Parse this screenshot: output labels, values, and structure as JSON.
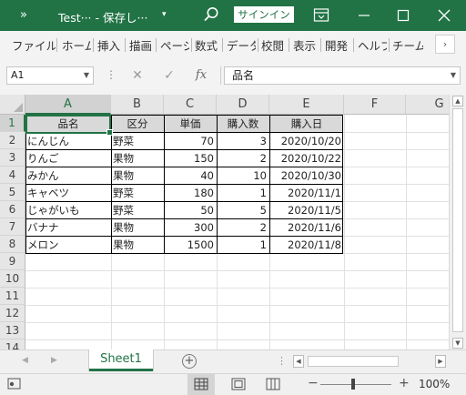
{
  "titlebar": {
    "quick_access": "»",
    "title": "Test··· - 保存し···",
    "title_dropdown": "▾",
    "signin": "サインイン"
  },
  "ribbon": {
    "tabs": [
      "ファイル",
      "ホーム",
      "挿入",
      "描画",
      "ページ",
      "数式",
      "データ",
      "校閲",
      "表示",
      "開発",
      "ヘルプ",
      "チーム"
    ]
  },
  "formula_bar": {
    "name_box": "A1",
    "cancel": "✕",
    "enter": "✓",
    "fx": "fx",
    "content": "品名",
    "dots": "⋮"
  },
  "grid": {
    "columns": [
      "A",
      "B",
      "C",
      "D",
      "E",
      "F",
      "G"
    ],
    "rows": [
      "1",
      "2",
      "3",
      "4",
      "5",
      "6",
      "7",
      "8",
      "9",
      "10",
      "11",
      "12",
      "13",
      "14"
    ],
    "header": [
      "品名",
      "区分",
      "単価",
      "購入数",
      "購入日"
    ],
    "data": [
      [
        "にんじん",
        "野菜",
        "70",
        "3",
        "2020/10/20"
      ],
      [
        "りんご",
        "果物",
        "150",
        "2",
        "2020/10/22"
      ],
      [
        "みかん",
        "果物",
        "40",
        "10",
        "2020/10/30"
      ],
      [
        "キャベツ",
        "野菜",
        "180",
        "1",
        "2020/11/1"
      ],
      [
        "じゃがいも",
        "野菜",
        "50",
        "5",
        "2020/11/5"
      ],
      [
        "バナナ",
        "果物",
        "300",
        "2",
        "2020/11/6"
      ],
      [
        "メロン",
        "果物",
        "1500",
        "1",
        "2020/11/8"
      ]
    ],
    "selected_cell": "A1"
  },
  "sheets": {
    "tabs": [
      "Sheet1"
    ],
    "active": "Sheet1",
    "add": "+",
    "dots": "⋮"
  },
  "status": {
    "zoom": "100%",
    "minus": "−",
    "plus": "+"
  }
}
